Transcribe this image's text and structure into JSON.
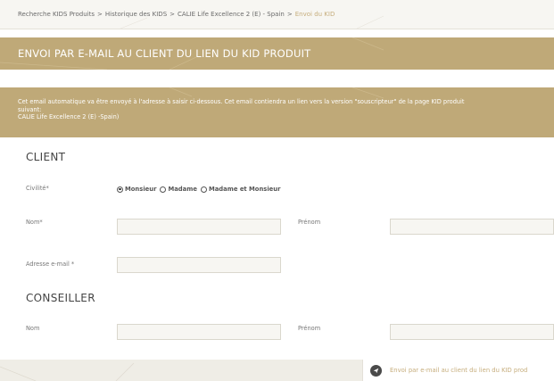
{
  "breadcrumb": {
    "items": [
      {
        "label": "Recherche KIDS Produits"
      },
      {
        "label": "Historique des KIDS"
      },
      {
        "label": "CALIE Life Excellence 2 (E) - Spain"
      }
    ],
    "separator": ">",
    "current": "Envoi du KID",
    "current_color": "#c6ad7c"
  },
  "title_bar": {
    "title": "ENVOI PAR E-MAIL AU CLIENT DU LIEN DU KID PRODUIT",
    "background": "#bfa978"
  },
  "info": {
    "line1": "Cet email automatique va être envoyé à l'adresse à saisir ci-dessous. Cet email contiendra un lien vers la version \"souscripteur\" de la page KID produit",
    "line2": "suivant:",
    "product": "CALIE Life Excellence 2 (E) -Spain)"
  },
  "client": {
    "section_title": "CLIENT",
    "civilite_label": "Civilité*",
    "civilite_options": [
      {
        "label": "Monsieur",
        "checked": true
      },
      {
        "label": "Madame",
        "checked": false
      },
      {
        "label": "Madame et Monsieur",
        "checked": false
      }
    ],
    "nom_label": "Nom*",
    "nom_value": "",
    "prenom_label": "Prénom",
    "prenom_value": "",
    "email_label": "Adresse e-mail *",
    "email_value": ""
  },
  "conseiller": {
    "section_title": "CONSEILLER",
    "nom_label": "Nom",
    "nom_value": "",
    "prenom_label": "Prénom",
    "prenom_value": ""
  },
  "footer": {
    "send_label": "Envoi par e-mail au client du lien du KID prod",
    "icon": "paper-plane-icon"
  }
}
